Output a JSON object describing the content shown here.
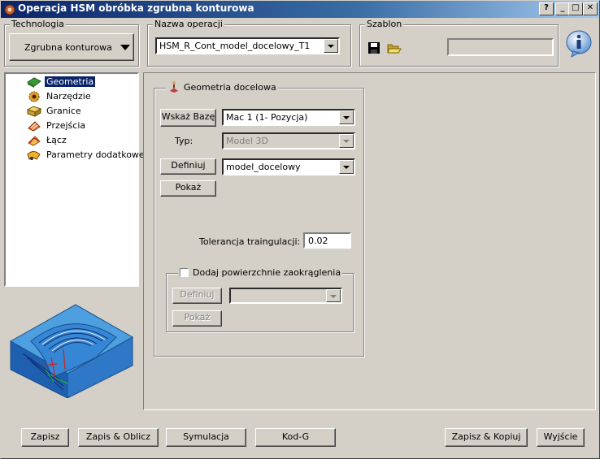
{
  "window": {
    "title": "Operacja HSM obróbka zgrubna konturowa",
    "help_btn": "?",
    "min_btn": "_",
    "max_btn": "□",
    "close_btn": "✕"
  },
  "technologia": {
    "legend": "Technologia",
    "value": "Zgrubna konturowa"
  },
  "nazwa": {
    "legend": "Nazwa operacji",
    "value": "HSM_R_Cont_model_docelowy_T1"
  },
  "szablon": {
    "legend": "Szablon",
    "value": ""
  },
  "tree": {
    "items": [
      {
        "label": "Geometria",
        "icon": "geometry-icon"
      },
      {
        "label": "Narzędzie",
        "icon": "tool-gear-icon"
      },
      {
        "label": "Granice",
        "icon": "boundary-icon"
      },
      {
        "label": "Przejścia",
        "icon": "passes-icon"
      },
      {
        "label": "Łącz",
        "icon": "links-icon"
      },
      {
        "label": "Parametry dodatkowe",
        "icon": "extra-params-icon"
      }
    ]
  },
  "geometria": {
    "legend": "Geometria docelowa",
    "wskaz_label": "Wskaż Bazę",
    "baza_value": "Mac 1 (1- Pozycja)",
    "typ_label": "Typ:",
    "typ_value": "Model 3D",
    "definiuj_label": "Definiuj",
    "model_value": "model_docelowy",
    "pokaz_label": "Pokaż",
    "tolerancja_label": "Tolerancja traingulacji:",
    "tolerancja_value": "0.02",
    "dodaj_label": "Dodaj powierzchnie zaokrąglenia",
    "definiuj2_label": "Definiuj",
    "pokaz2_label": "Pokaż"
  },
  "footer": {
    "zapisz": "Zapisz",
    "zapis_oblicz": "Zapis & Oblicz",
    "symulacja": "Symulacja",
    "kodg": "Kod-G",
    "zapisz_kopiuj": "Zapisz & Kopiuj",
    "wyjscie": "Wyjście"
  }
}
